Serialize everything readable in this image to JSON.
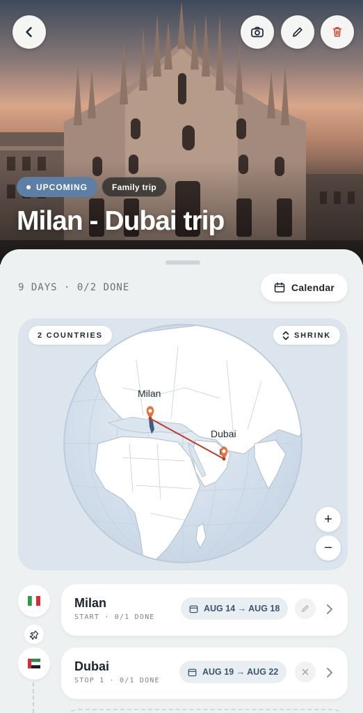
{
  "header": {
    "back_icon": "chevron-left-icon",
    "actions": [
      {
        "icon": "camera-icon"
      },
      {
        "icon": "pencil-icon"
      },
      {
        "icon": "trash-icon",
        "color": "#d0452c"
      }
    ],
    "status_badge": "UPCOMING",
    "tag_badge": "Family trip",
    "title": "Milan - Dubai trip"
  },
  "summary": {
    "text": "9 DAYS · 0/2 DONE",
    "calendar_label": "Calendar"
  },
  "map": {
    "countries_label": "2 COUNTRIES",
    "shrink_label": "SHRINK",
    "zoom_in": "+",
    "zoom_out": "−",
    "route_color": "#c0392b",
    "pin_color": "#e0733f",
    "cities": [
      {
        "name": "Milan"
      },
      {
        "name": "Dubai"
      }
    ]
  },
  "stops": [
    {
      "name": "Milan",
      "sub": "START · 0/1 DONE",
      "dates": "AUG 14 → AUG 18",
      "flag": "italy-flag-icon",
      "action_icon": "pencil-icon"
    },
    {
      "name": "Dubai",
      "sub": "STOP 1 · 0/1 DONE",
      "dates": "AUG 19 → AUG 22",
      "flag": "uae-flag-icon",
      "action_icon": "close-icon"
    }
  ],
  "colors": {
    "accent": "#5d7fa6",
    "date_text": "#3a5572",
    "danger": "#d0452c"
  }
}
